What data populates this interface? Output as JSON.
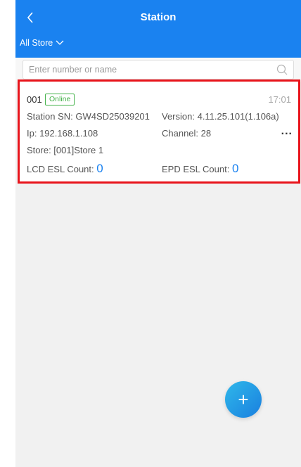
{
  "header": {
    "title": "Station",
    "store_filter": "All Store"
  },
  "search": {
    "placeholder": "Enter number or name"
  },
  "station": {
    "id": "001",
    "status": "Online",
    "time": "17:01",
    "sn_label": "Station SN: GW4SD25039201",
    "version_label": "Version: 4.11.25.101(1.106a)",
    "ip_label": "Ip: 192.168.1.108",
    "channel_label": "Channel: 28",
    "store_label": "Store: [001]Store 1",
    "lcd_label": "LCD ESL Count: ",
    "lcd_count": "0",
    "epd_label": "EPD ESL Count: ",
    "epd_count": "0",
    "more": "..."
  },
  "fab": {
    "label": "+"
  },
  "colors": {
    "header": "#1a82f0",
    "online": "#45b24b",
    "highlight": "#e8141b",
    "count": "#1a82f0"
  }
}
